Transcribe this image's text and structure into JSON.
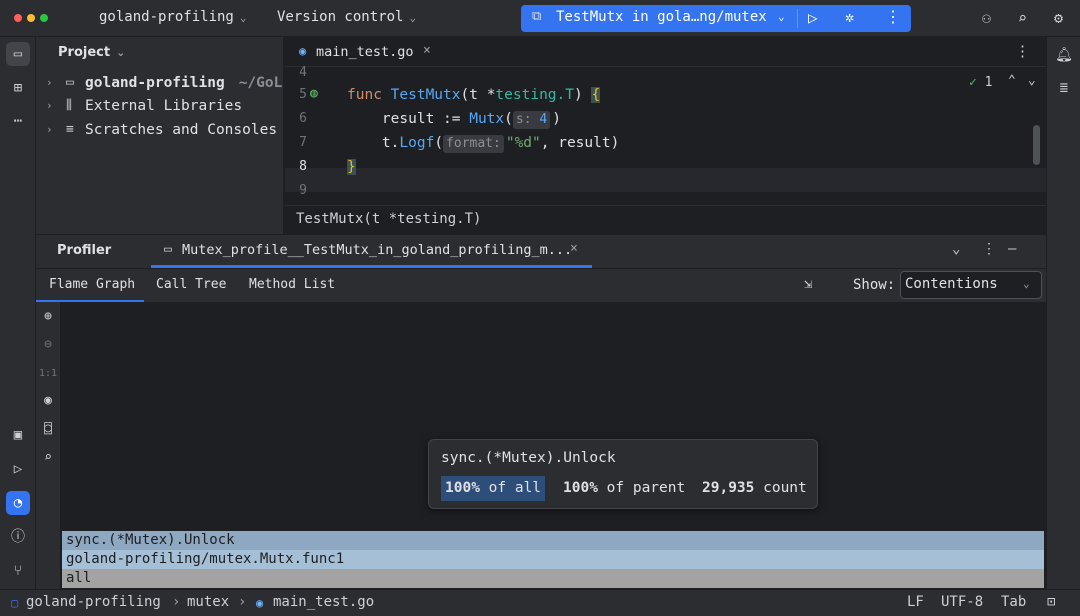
{
  "titlebar": {
    "project_name": "goland-profiling",
    "vcs_label": "Version control",
    "run_config": "TestMutx in gola…ng/mutex",
    "icons": [
      "user-add-icon",
      "search-icon",
      "settings-icon"
    ]
  },
  "project_panel": {
    "title": "Project",
    "items": [
      {
        "label": "goland-profiling",
        "path": "~/GoL",
        "icon": "folder-icon",
        "bold": true
      },
      {
        "label": "External Libraries",
        "path": "",
        "icon": "library-icon",
        "bold": false
      },
      {
        "label": "Scratches and Consoles",
        "path": "",
        "icon": "scratches-icon",
        "bold": false
      }
    ]
  },
  "editor": {
    "tab_name": "main_test.go",
    "line_numbers": [
      "4",
      "5",
      "6",
      "7",
      "8",
      "9"
    ],
    "code": {
      "l5_kw": "func",
      "l5_name": "TestMutx",
      "l5_args_open": "(t *",
      "l5_type": "testing.T",
      "l5_args_close": ") ",
      "l5_brace": "{",
      "l6_pre": "    result := ",
      "l6_call": "Mutx",
      "l6_paren": "(",
      "l6_hint": "s:",
      "l6_hint_val": "4",
      "l6_close": ")",
      "l7_pre": "    t.",
      "l7_call": "Logf",
      "l7_paren": "(",
      "l7_hint": "format:",
      "l7_str": "\"%d\"",
      "l7_rest": ", result)",
      "l8_brace": "}"
    },
    "inspection_count": "1",
    "breadcrumb": "TestMutx(t *testing.T)"
  },
  "profiler": {
    "title": "Profiler",
    "tab_label": "Mutex_profile__TestMutx_in_goland_profiling_m...",
    "subtabs": [
      "Flame Graph",
      "Call Tree",
      "Method List"
    ],
    "show_label": "Show:",
    "show_value": "Contentions",
    "zoom_reset_label": "1:1",
    "frames": [
      {
        "label": "sync.(*Mutex).Unlock",
        "color": "#8fa8c2"
      },
      {
        "label": "goland-profiling/mutex.Mutx.func1",
        "color": "#a5bfd6"
      },
      {
        "label": "all",
        "color": "#a3a3a3"
      }
    ],
    "tooltip": {
      "title": "sync.(*Mutex).Unlock",
      "pct_all": "100%",
      "pct_all_suffix": " of all",
      "pct_parent": "100%",
      "pct_parent_suffix": " of parent",
      "count": "29,935",
      "count_suffix": " count"
    }
  },
  "statusbar": {
    "breadcrumbs": [
      "goland-profiling",
      "mutex",
      "main_test.go"
    ],
    "line_sep": "LF",
    "encoding": "UTF-8",
    "indent": "Tab"
  },
  "colors": {
    "accent": "#3574f0",
    "bg_panel": "#2b2d30",
    "bg_editor": "#1e1f22"
  }
}
